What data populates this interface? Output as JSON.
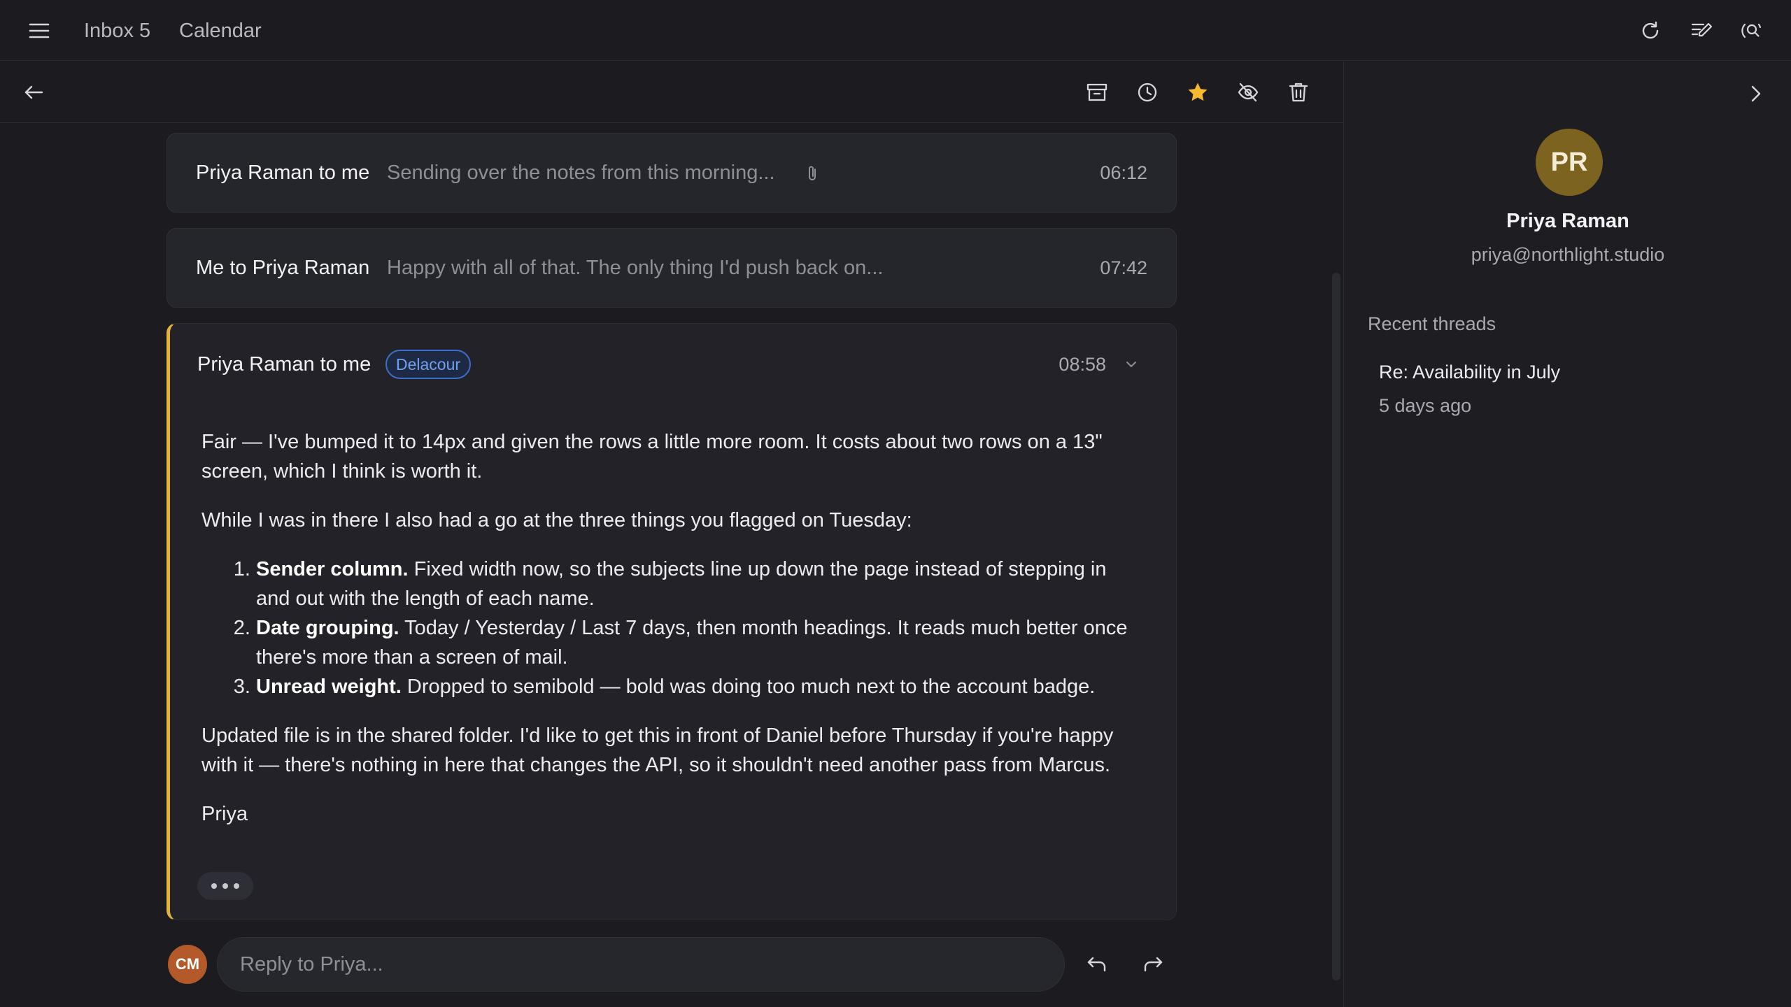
{
  "topbar": {
    "inbox_label": "Inbox 5",
    "calendar_label": "Calendar",
    "icons": [
      "menu-icon",
      "refresh-icon",
      "compose-icon",
      "account-search-icon"
    ]
  },
  "toolbar": {
    "icons": [
      "back-arrow-icon",
      "archive-icon",
      "snooze-clock-icon",
      "star-icon",
      "hide-icon",
      "trash-icon"
    ],
    "star_color": "#f5b82e"
  },
  "messages": [
    {
      "from": "Priya Raman to me",
      "snippet": "Sending over the notes from this morning...",
      "time": "06:12",
      "has_attachment": true
    },
    {
      "from": "Me to Priya Raman",
      "snippet": "Happy with all of that. The only thing I'd push back on...",
      "time": "07:42"
    }
  ],
  "open_message": {
    "from": "Priya Raman to me",
    "badge": "Delacour",
    "time": "08:58",
    "accent_color": "#e2b33c",
    "para1": "Fair — I've bumped it to 14px and given the rows a little more room. It costs about two rows on a 13\" screen, which I think is worth it.",
    "para2": "While I was in there I also had a go at the three things you flagged on Tuesday:",
    "list": [
      {
        "bold": "Sender column.",
        "text": " Fixed width now, so the subjects line up down the page instead of stepping in and out with the length of each name."
      },
      {
        "bold": "Date grouping.",
        "text": " Today / Yesterday / Last 7 days, then month headings. It reads much better once there's more than a screen of mail."
      },
      {
        "bold": "Unread weight.",
        "text": " Dropped to semibold — bold was doing too much next to the account badge."
      }
    ],
    "para3": "Updated file is in the shared folder. I'd like to get this in front of Daniel before Thursday if you're happy with it — there's nothing in here that changes the API, so it shouldn't need another pass from Marcus.",
    "signature": "Priya"
  },
  "reply": {
    "avatar_initials": "CM",
    "placeholder": "Reply to Priya..."
  },
  "sidepanel": {
    "avatar_initials": "PR",
    "name": "Priya Raman",
    "email": "priya@northlight.studio",
    "recent_title": "Recent threads",
    "threads": [
      {
        "subject": "Re: Availability in July",
        "when": "5 days ago"
      }
    ]
  }
}
